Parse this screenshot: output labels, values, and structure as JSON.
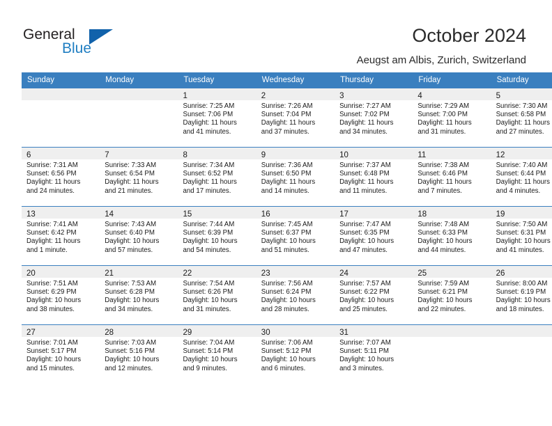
{
  "brand": {
    "name_part1": "General",
    "name_part2": "Blue",
    "triangle_color": "#1162AB",
    "blue_color": "#1F7EC2"
  },
  "header": {
    "title": "October 2024",
    "subtitle": "Aeugst am Albis, Zurich, Switzerland",
    "accent_color": "#3A7FBF",
    "band_color": "#EFEFEF"
  },
  "weekday_headers": [
    "Sunday",
    "Monday",
    "Tuesday",
    "Wednesday",
    "Thursday",
    "Friday",
    "Saturday"
  ],
  "weeks": [
    [
      {
        "day": "",
        "lines": []
      },
      {
        "day": "",
        "lines": []
      },
      {
        "day": "1",
        "lines": [
          "Sunrise: 7:25 AM",
          "Sunset: 7:06 PM",
          "Daylight: 11 hours",
          "and 41 minutes."
        ]
      },
      {
        "day": "2",
        "lines": [
          "Sunrise: 7:26 AM",
          "Sunset: 7:04 PM",
          "Daylight: 11 hours",
          "and 37 minutes."
        ]
      },
      {
        "day": "3",
        "lines": [
          "Sunrise: 7:27 AM",
          "Sunset: 7:02 PM",
          "Daylight: 11 hours",
          "and 34 minutes."
        ]
      },
      {
        "day": "4",
        "lines": [
          "Sunrise: 7:29 AM",
          "Sunset: 7:00 PM",
          "Daylight: 11 hours",
          "and 31 minutes."
        ]
      },
      {
        "day": "5",
        "lines": [
          "Sunrise: 7:30 AM",
          "Sunset: 6:58 PM",
          "Daylight: 11 hours",
          "and 27 minutes."
        ]
      }
    ],
    [
      {
        "day": "6",
        "lines": [
          "Sunrise: 7:31 AM",
          "Sunset: 6:56 PM",
          "Daylight: 11 hours",
          "and 24 minutes."
        ]
      },
      {
        "day": "7",
        "lines": [
          "Sunrise: 7:33 AM",
          "Sunset: 6:54 PM",
          "Daylight: 11 hours",
          "and 21 minutes."
        ]
      },
      {
        "day": "8",
        "lines": [
          "Sunrise: 7:34 AM",
          "Sunset: 6:52 PM",
          "Daylight: 11 hours",
          "and 17 minutes."
        ]
      },
      {
        "day": "9",
        "lines": [
          "Sunrise: 7:36 AM",
          "Sunset: 6:50 PM",
          "Daylight: 11 hours",
          "and 14 minutes."
        ]
      },
      {
        "day": "10",
        "lines": [
          "Sunrise: 7:37 AM",
          "Sunset: 6:48 PM",
          "Daylight: 11 hours",
          "and 11 minutes."
        ]
      },
      {
        "day": "11",
        "lines": [
          "Sunrise: 7:38 AM",
          "Sunset: 6:46 PM",
          "Daylight: 11 hours",
          "and 7 minutes."
        ]
      },
      {
        "day": "12",
        "lines": [
          "Sunrise: 7:40 AM",
          "Sunset: 6:44 PM",
          "Daylight: 11 hours",
          "and 4 minutes."
        ]
      }
    ],
    [
      {
        "day": "13",
        "lines": [
          "Sunrise: 7:41 AM",
          "Sunset: 6:42 PM",
          "Daylight: 11 hours",
          "and 1 minute."
        ]
      },
      {
        "day": "14",
        "lines": [
          "Sunrise: 7:43 AM",
          "Sunset: 6:40 PM",
          "Daylight: 10 hours",
          "and 57 minutes."
        ]
      },
      {
        "day": "15",
        "lines": [
          "Sunrise: 7:44 AM",
          "Sunset: 6:39 PM",
          "Daylight: 10 hours",
          "and 54 minutes."
        ]
      },
      {
        "day": "16",
        "lines": [
          "Sunrise: 7:45 AM",
          "Sunset: 6:37 PM",
          "Daylight: 10 hours",
          "and 51 minutes."
        ]
      },
      {
        "day": "17",
        "lines": [
          "Sunrise: 7:47 AM",
          "Sunset: 6:35 PM",
          "Daylight: 10 hours",
          "and 47 minutes."
        ]
      },
      {
        "day": "18",
        "lines": [
          "Sunrise: 7:48 AM",
          "Sunset: 6:33 PM",
          "Daylight: 10 hours",
          "and 44 minutes."
        ]
      },
      {
        "day": "19",
        "lines": [
          "Sunrise: 7:50 AM",
          "Sunset: 6:31 PM",
          "Daylight: 10 hours",
          "and 41 minutes."
        ]
      }
    ],
    [
      {
        "day": "20",
        "lines": [
          "Sunrise: 7:51 AM",
          "Sunset: 6:29 PM",
          "Daylight: 10 hours",
          "and 38 minutes."
        ]
      },
      {
        "day": "21",
        "lines": [
          "Sunrise: 7:53 AM",
          "Sunset: 6:28 PM",
          "Daylight: 10 hours",
          "and 34 minutes."
        ]
      },
      {
        "day": "22",
        "lines": [
          "Sunrise: 7:54 AM",
          "Sunset: 6:26 PM",
          "Daylight: 10 hours",
          "and 31 minutes."
        ]
      },
      {
        "day": "23",
        "lines": [
          "Sunrise: 7:56 AM",
          "Sunset: 6:24 PM",
          "Daylight: 10 hours",
          "and 28 minutes."
        ]
      },
      {
        "day": "24",
        "lines": [
          "Sunrise: 7:57 AM",
          "Sunset: 6:22 PM",
          "Daylight: 10 hours",
          "and 25 minutes."
        ]
      },
      {
        "day": "25",
        "lines": [
          "Sunrise: 7:59 AM",
          "Sunset: 6:21 PM",
          "Daylight: 10 hours",
          "and 22 minutes."
        ]
      },
      {
        "day": "26",
        "lines": [
          "Sunrise: 8:00 AM",
          "Sunset: 6:19 PM",
          "Daylight: 10 hours",
          "and 18 minutes."
        ]
      }
    ],
    [
      {
        "day": "27",
        "lines": [
          "Sunrise: 7:01 AM",
          "Sunset: 5:17 PM",
          "Daylight: 10 hours",
          "and 15 minutes."
        ]
      },
      {
        "day": "28",
        "lines": [
          "Sunrise: 7:03 AM",
          "Sunset: 5:16 PM",
          "Daylight: 10 hours",
          "and 12 minutes."
        ]
      },
      {
        "day": "29",
        "lines": [
          "Sunrise: 7:04 AM",
          "Sunset: 5:14 PM",
          "Daylight: 10 hours",
          "and 9 minutes."
        ]
      },
      {
        "day": "30",
        "lines": [
          "Sunrise: 7:06 AM",
          "Sunset: 5:12 PM",
          "Daylight: 10 hours",
          "and 6 minutes."
        ]
      },
      {
        "day": "31",
        "lines": [
          "Sunrise: 7:07 AM",
          "Sunset: 5:11 PM",
          "Daylight: 10 hours",
          "and 3 minutes."
        ]
      },
      {
        "day": "",
        "lines": []
      },
      {
        "day": "",
        "lines": []
      }
    ]
  ]
}
